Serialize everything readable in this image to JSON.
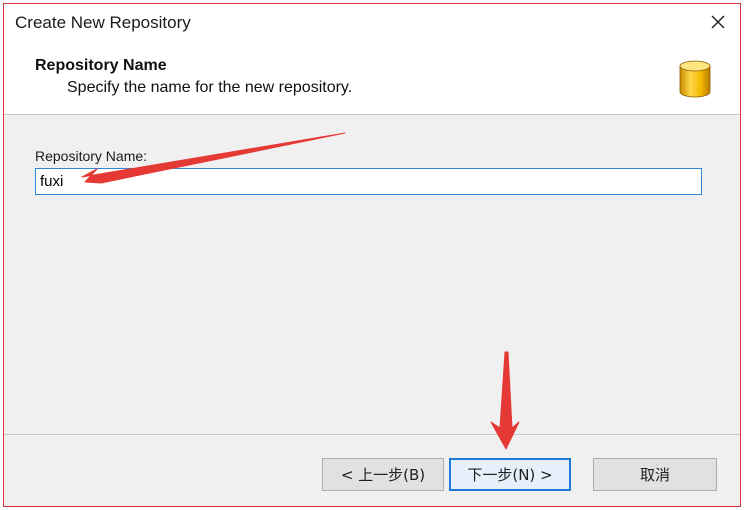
{
  "window": {
    "title": "Create New Repository"
  },
  "header": {
    "title": "Repository Name",
    "subtitle": "Specify the name for the new repository."
  },
  "form": {
    "label": "Repository Name:",
    "value": "fuxi"
  },
  "buttons": {
    "back": "< 上一步(B)",
    "next": "下一步(N) >",
    "cancel": "取消"
  },
  "colors": {
    "annotation_arrow": "#e53935",
    "input_focus_border": "#2f86d6",
    "default_button_border": "#1e7ad6",
    "window_border": "#d9353a"
  },
  "icons": {
    "header": "database-cylinder-icon",
    "close": "close-icon"
  }
}
